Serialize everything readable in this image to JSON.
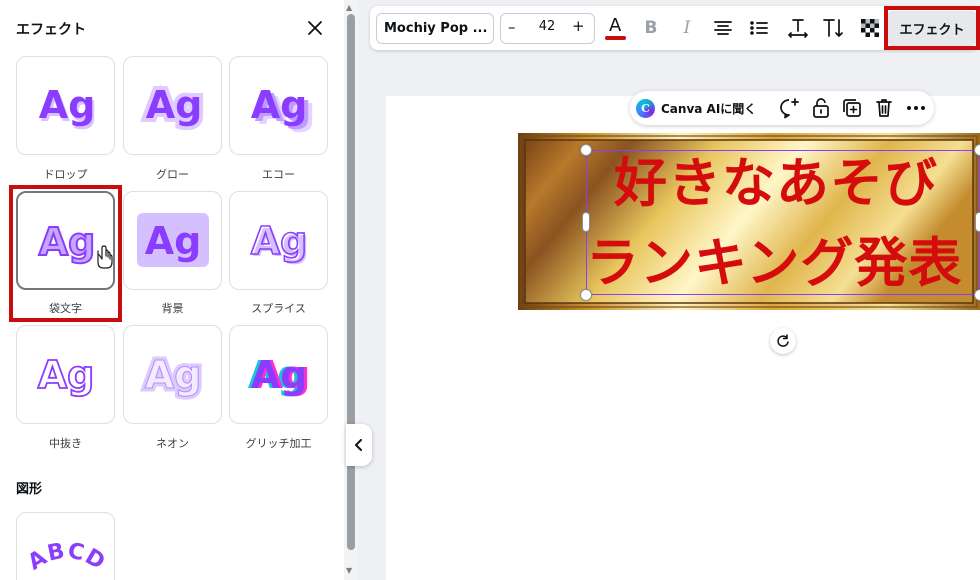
{
  "panel": {
    "title": "エフェクト",
    "effects": [
      {
        "label": "ドロップ",
        "preview": "Ag",
        "state": "normal"
      },
      {
        "label": "グロー",
        "preview": "Ag",
        "state": "normal"
      },
      {
        "label": "エコー",
        "preview": "Ag",
        "state": "normal"
      },
      {
        "label": "袋文字",
        "preview": "Ag",
        "state": "hovered",
        "highlighted": true
      },
      {
        "label": "背景",
        "preview": "Ag",
        "state": "normal"
      },
      {
        "label": "スプライス",
        "preview": "Ag",
        "state": "normal"
      },
      {
        "label": "中抜き",
        "preview": "Ag",
        "state": "normal"
      },
      {
        "label": "ネオン",
        "preview": "Ag",
        "state": "normal"
      },
      {
        "label": "グリッチ加工",
        "preview": "Ag",
        "state": "normal"
      }
    ],
    "shape_section_title": "図形",
    "shape_preview": "ABCD"
  },
  "toolbar": {
    "font_name": "Mochiy Pop ...",
    "font_size": "42",
    "minus": "–",
    "plus": "+",
    "text_color_glyph": "A",
    "text_color": "#c90c0c",
    "bold_glyph": "B",
    "italic_glyph": "I",
    "effect_label": "エフェクト",
    "effect_highlighted": true
  },
  "context_menu": {
    "ai_label": "Canva AIに聞く",
    "ai_logo_glyph": "C",
    "icons": [
      "comment-plus-icon",
      "lock-icon",
      "duplicate-icon",
      "trash-icon",
      "more-icon"
    ]
  },
  "canvas": {
    "text_lines": [
      "好きなあそび",
      "ランキング発表"
    ],
    "text_color": "#d40c0c",
    "frame_color": "#8b3dff"
  },
  "colors": {
    "highlight_red": "#c90c0c",
    "effect_purple": "#8b3dff",
    "panel_border": "#dcdfe4"
  }
}
